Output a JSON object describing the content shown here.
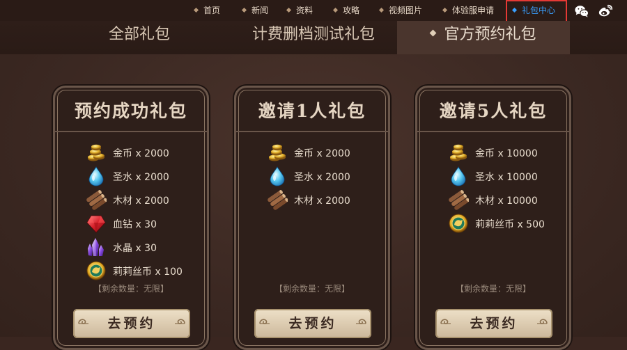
{
  "nav": {
    "items": [
      "首页",
      "新闻",
      "资料",
      "攻略",
      "视频图片",
      "体验服申请",
      "礼包中心"
    ],
    "active_index": 6
  },
  "social": {
    "icons": [
      "wechat-icon",
      "weibo-icon"
    ]
  },
  "tabs": {
    "items": [
      "全部礼包",
      "计费删档测试礼包",
      "官方预约礼包"
    ],
    "active_index": 2
  },
  "cards": [
    {
      "title": "预约成功礼包",
      "items": [
        {
          "icon": "gold-coins-icon",
          "label": "金币 x 2000"
        },
        {
          "icon": "holy-water-icon",
          "label": "圣水 x 2000"
        },
        {
          "icon": "wood-icon",
          "label": "木材 x 2000"
        },
        {
          "icon": "blood-diamond-icon",
          "label": "血钻 x 30"
        },
        {
          "icon": "crystal-icon",
          "label": "水晶 x 30"
        },
        {
          "icon": "lily-coin-icon",
          "label": "莉莉丝币 x 100"
        }
      ],
      "remain": "【剩余数量：无限】",
      "button": "去预约"
    },
    {
      "title": "邀请1人礼包",
      "items": [
        {
          "icon": "gold-coins-icon",
          "label": "金币 x 2000"
        },
        {
          "icon": "holy-water-icon",
          "label": "圣水 x 2000"
        },
        {
          "icon": "wood-icon",
          "label": "木材 x 2000"
        }
      ],
      "remain": "【剩余数量：无限】",
      "button": "去预约"
    },
    {
      "title": "邀请5人礼包",
      "items": [
        {
          "icon": "gold-coins-icon",
          "label": "金币 x 10000"
        },
        {
          "icon": "holy-water-icon",
          "label": "圣水 x 10000"
        },
        {
          "icon": "wood-icon",
          "label": "木材 x 10000"
        },
        {
          "icon": "lily-coin-icon",
          "label": "莉莉丝币 x 500"
        }
      ],
      "remain": "【剩余数量：无限】",
      "button": "去预约"
    }
  ],
  "colors": {
    "active_nav": "#3aa0ff",
    "highlight_box": "#e53935",
    "page_bg": "#3a2620"
  }
}
